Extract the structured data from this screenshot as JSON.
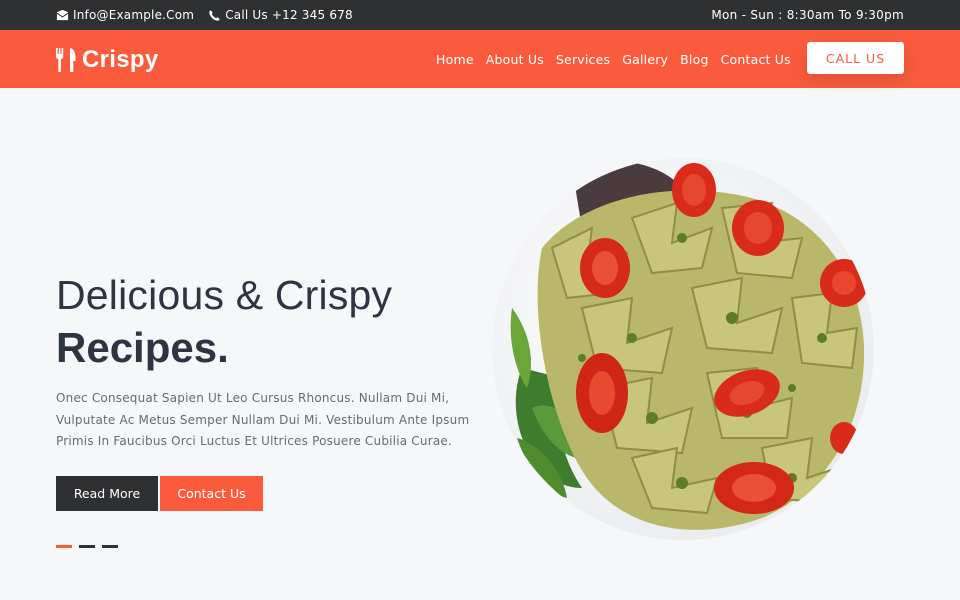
{
  "topbar": {
    "email": "Info@Example.Com",
    "phone": "Call Us +12 345 678",
    "hours": "Mon - Sun : 8:30am To 9:30pm"
  },
  "brand": {
    "name": "Crispy",
    "accent": "#fa5b3d",
    "dark": "#2f3032"
  },
  "nav": {
    "items": [
      "Home",
      "About Us",
      "Services",
      "Gallery",
      "Blog",
      "Contact Us"
    ],
    "cta": "CALL US"
  },
  "hero": {
    "title": "Delicious & Crispy",
    "title_strong": "Recipes.",
    "description": "Onec Consequat Sapien Ut Leo Cursus Rhoncus. Nullam Dui Mi, Vulputate Ac Metus Semper Nullam Dui Mi. Vestibulum Ante Ipsum Primis In Faucibus Orci Luctus Et Ultrices Posuere Cubilia Curae.",
    "btn_read": "Read More",
    "btn_contact": "Contact Us",
    "slide_count": 3,
    "active_slide": 1
  },
  "icons": {
    "email": "envelope-icon",
    "phone": "phone-icon",
    "logo": "fork-knife-icon"
  }
}
